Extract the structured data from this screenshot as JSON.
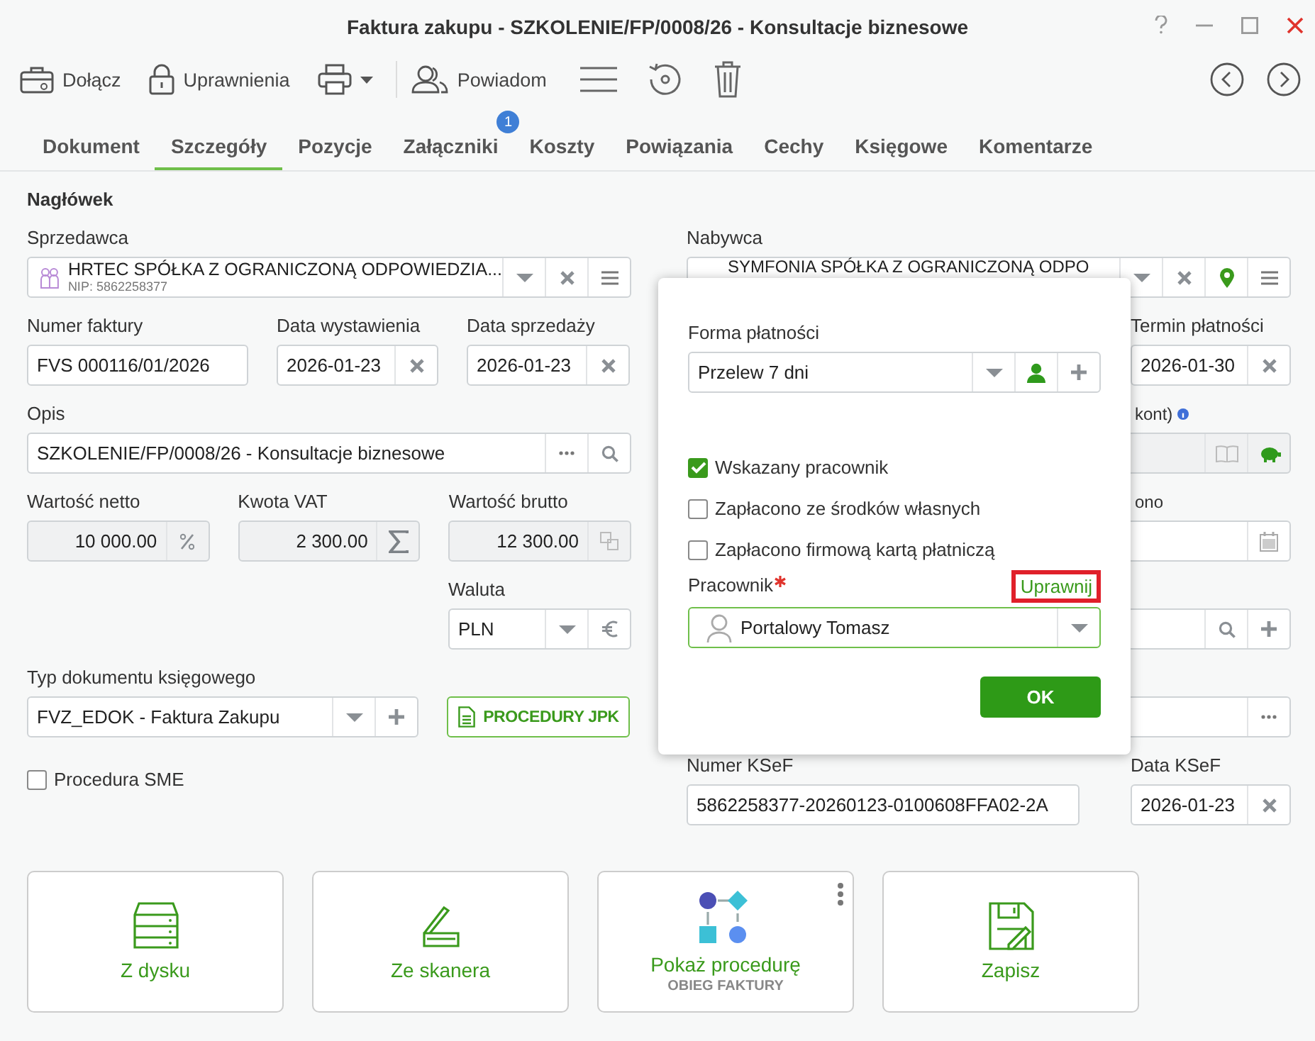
{
  "window": {
    "title": "Faktura zakupu - SZKOLENIE/FP/0008/26 - Konsultacje biznesowe"
  },
  "toolbar": [
    {
      "label": "Dołącz"
    },
    {
      "label": "Uprawnienia"
    },
    {
      "label": "Powiadom"
    }
  ],
  "tabs": [
    {
      "label": "Dokument",
      "selected": false
    },
    {
      "label": "Szczegóły",
      "selected": true
    },
    {
      "label": "Pozycje",
      "selected": false
    },
    {
      "label": "Załączniki",
      "selected": false,
      "badge": "1"
    },
    {
      "label": "Koszty",
      "selected": false
    },
    {
      "label": "Powiązania",
      "selected": false
    },
    {
      "label": "Cechy",
      "selected": false
    },
    {
      "label": "Księgowe",
      "selected": false
    },
    {
      "label": "Komentarze",
      "selected": false
    }
  ],
  "header": {
    "title": "Nagłówek"
  },
  "seller": {
    "label": "Sprzedawca",
    "value": "HRTEC SPÓŁKA Z OGRANICZONĄ ODPOWIEDZIA...",
    "nip": "NIP: 5862258377"
  },
  "buyer": {
    "label": "Nabywca",
    "value": "SYMFONIA SPÓŁKA Z OGRANICZONĄ ODPO"
  },
  "invoice_number": {
    "label": "Numer faktury",
    "value": "FVS 000116/01/2026"
  },
  "issue_date": {
    "label": "Data wystawienia",
    "value": "2026-01-23"
  },
  "sale_date": {
    "label": "Data sprzedaży",
    "value": "2026-01-23"
  },
  "payment_due": {
    "label": "Termin płatności",
    "value": "2026-01-30"
  },
  "description": {
    "label": "Opis",
    "value": "SZKOLENIE/FP/0008/26 - Konsultacje biznesowe"
  },
  "account": {
    "label": "kont)",
    "disabled": true
  },
  "net": {
    "label": "Wartość netto",
    "value": "10 000.00",
    "disabled": true
  },
  "vat": {
    "label": "Kwota VAT",
    "value": "2 300.00",
    "disabled": true
  },
  "gross": {
    "label": "Wartość brutto",
    "value": "12 300.00",
    "disabled": true
  },
  "paid_date": {
    "label": "ono"
  },
  "currency": {
    "label": "Waluta",
    "value": "PLN"
  },
  "document_type": {
    "label": "Typ dokumentu księgowego",
    "value": "FVZ_EDOK - Faktura Zakupu"
  },
  "jpk_button": "PROCEDURY JPK",
  "sme": {
    "label": "Procedura SME",
    "checked": false
  },
  "ksef_number": {
    "label": "Numer KSeF",
    "value": "5862258377-20260123-0100608FFA02-2A"
  },
  "ksef_date": {
    "label": "Data KSeF",
    "value": "2026-01-23"
  },
  "tiles": [
    {
      "label": "Z dysku"
    },
    {
      "label": "Ze skanera"
    },
    {
      "label": "Pokaż procedurę",
      "sublabel": "OBIEG FAKTURY"
    },
    {
      "label": "Zapisz"
    }
  ],
  "popup": {
    "payment_form": {
      "label": "Forma płatności",
      "value": "Przelew 7 dni"
    },
    "options": [
      {
        "label": "Wskazany pracownik",
        "checked": true
      },
      {
        "label": "Zapłacono ze środków własnych",
        "checked": false
      },
      {
        "label": "Zapłacono firmową kartą płatniczą",
        "checked": false
      }
    ],
    "employee": {
      "label": "Pracownik",
      "required": true,
      "value": "Portalowy Tomasz",
      "link": "Uprawnij",
      "link_highlighted": true
    },
    "ok": "OK"
  }
}
